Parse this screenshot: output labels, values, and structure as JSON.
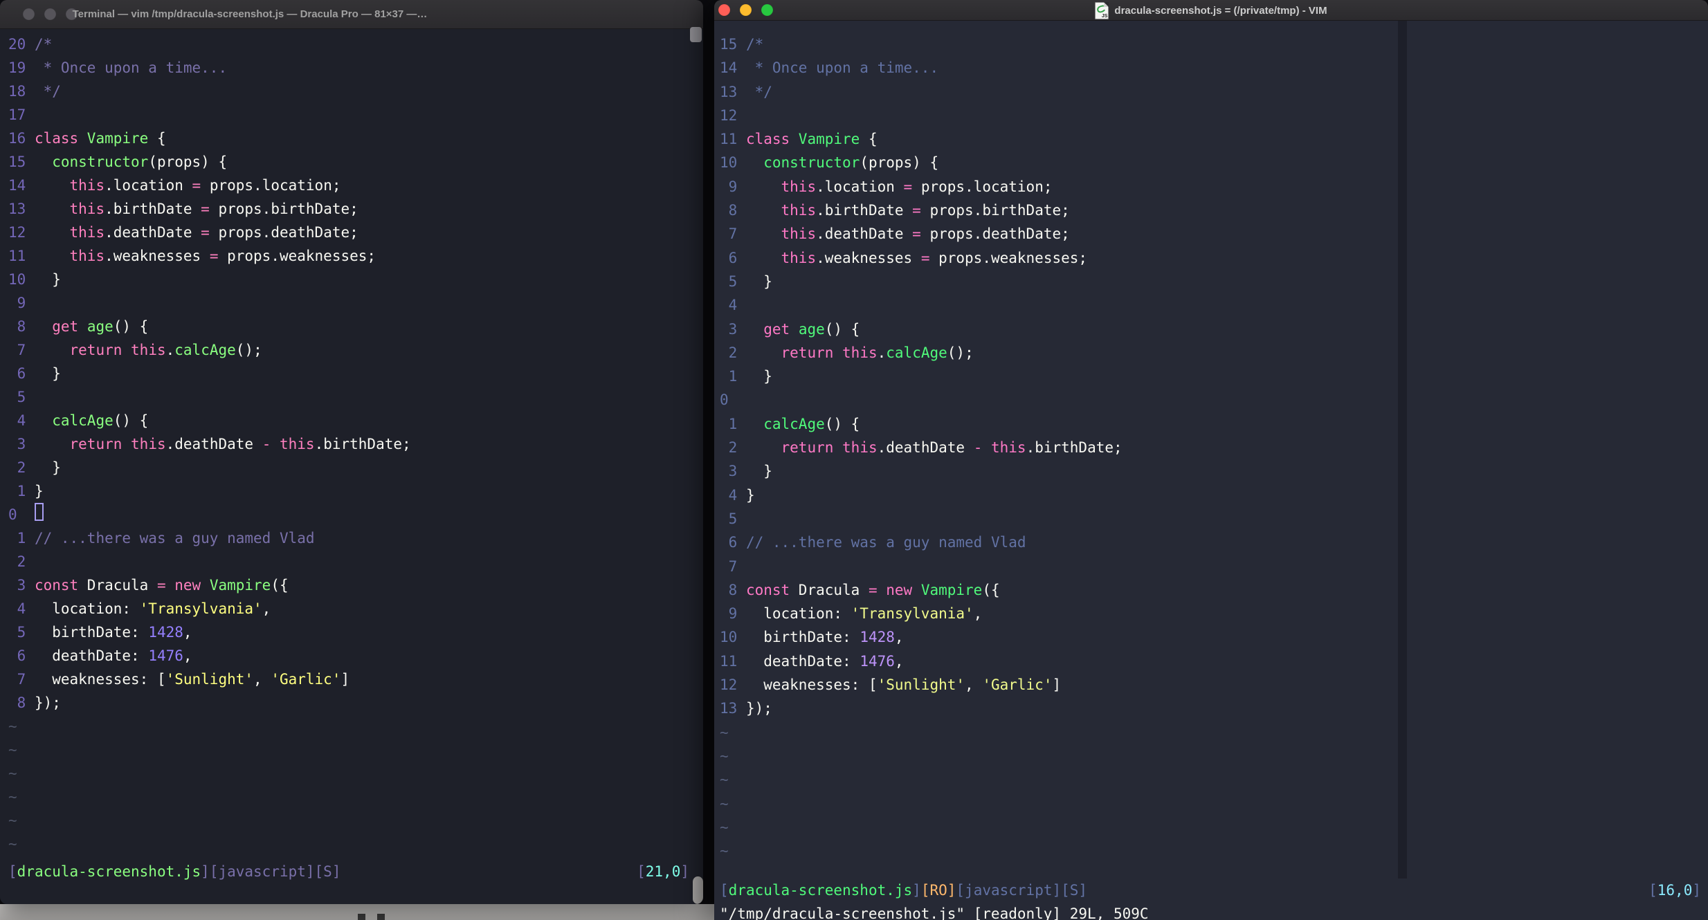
{
  "palettes": {
    "dracula_pro": {
      "bg": "#1E2029",
      "fg": "#F8F8F2",
      "comment": "#7970A9",
      "linenr": "#7467B8",
      "pink": "#FF80BF",
      "green": "#8AFF80",
      "purple": "#9580FF",
      "yellow": "#FFFF80",
      "cyan": "#80FFEA",
      "orange": "#FFCA80",
      "tilde": "#4E5467",
      "cursor": "#A79DF0",
      "colorcolumn": "#1E2029"
    },
    "dracula": {
      "bg": "#262935",
      "fg": "#F8F8F2",
      "comment": "#6272A4",
      "linenr": "#6272A4",
      "pink": "#FF79C6",
      "green": "#50FA7B",
      "purple": "#BD93F9",
      "yellow": "#F1FA8C",
      "cyan": "#8BE9FD",
      "orange": "#FFB86C",
      "tilde": "#565F7C",
      "cursor": "#F8F8F2",
      "colorcolumn": "#1D1F29"
    }
  },
  "code_lines": [
    {
      "t": [
        [
          "c",
          "/*"
        ]
      ]
    },
    {
      "t": [
        [
          "c",
          " * Once upon a time..."
        ]
      ]
    },
    {
      "t": [
        [
          "c",
          " */"
        ]
      ]
    },
    {
      "t": []
    },
    {
      "t": [
        [
          "k",
          "class "
        ],
        [
          "g",
          "Vampire"
        ],
        [
          "w",
          " {"
        ]
      ]
    },
    {
      "t": [
        [
          "w",
          "  "
        ],
        [
          "g",
          "constructor"
        ],
        [
          "w",
          "(props) {"
        ]
      ]
    },
    {
      "t": [
        [
          "w",
          "    "
        ],
        [
          "k",
          "this"
        ],
        [
          "w",
          ".location "
        ],
        [
          "k",
          "="
        ],
        [
          "w",
          " props.location;"
        ]
      ]
    },
    {
      "t": [
        [
          "w",
          "    "
        ],
        [
          "k",
          "this"
        ],
        [
          "w",
          ".birthDate "
        ],
        [
          "k",
          "="
        ],
        [
          "w",
          " props.birthDate;"
        ]
      ]
    },
    {
      "t": [
        [
          "w",
          "    "
        ],
        [
          "k",
          "this"
        ],
        [
          "w",
          ".deathDate "
        ],
        [
          "k",
          "="
        ],
        [
          "w",
          " props.deathDate;"
        ]
      ]
    },
    {
      "t": [
        [
          "w",
          "    "
        ],
        [
          "k",
          "this"
        ],
        [
          "w",
          ".weaknesses "
        ],
        [
          "k",
          "="
        ],
        [
          "w",
          " props.weaknesses;"
        ]
      ]
    },
    {
      "t": [
        [
          "w",
          "  }"
        ]
      ]
    },
    {
      "t": []
    },
    {
      "t": [
        [
          "w",
          "  "
        ],
        [
          "k",
          "get "
        ],
        [
          "g",
          "age"
        ],
        [
          "w",
          "() {"
        ]
      ]
    },
    {
      "t": [
        [
          "w",
          "    "
        ],
        [
          "k",
          "return "
        ],
        [
          "k",
          "this"
        ],
        [
          "w",
          "."
        ],
        [
          "g",
          "calcAge"
        ],
        [
          "w",
          "();"
        ]
      ]
    },
    {
      "t": [
        [
          "w",
          "  }"
        ]
      ]
    },
    {
      "t": []
    },
    {
      "t": [
        [
          "w",
          "  "
        ],
        [
          "g",
          "calcAge"
        ],
        [
          "w",
          "() {"
        ]
      ]
    },
    {
      "t": [
        [
          "w",
          "    "
        ],
        [
          "k",
          "return "
        ],
        [
          "k",
          "this"
        ],
        [
          "w",
          ".deathDate "
        ],
        [
          "k",
          "-"
        ],
        [
          "w",
          " "
        ],
        [
          "k",
          "this"
        ],
        [
          "w",
          ".birthDate;"
        ]
      ]
    },
    {
      "t": [
        [
          "w",
          "  }"
        ]
      ]
    },
    {
      "t": [
        [
          "w",
          "}"
        ]
      ]
    },
    {
      "t": []
    },
    {
      "t": [
        [
          "c",
          "// ...there was a guy named Vlad"
        ]
      ]
    },
    {
      "t": []
    },
    {
      "t": [
        [
          "k",
          "const "
        ],
        [
          "w",
          "Dracula "
        ],
        [
          "k",
          "= new "
        ],
        [
          "g",
          "Vampire"
        ],
        [
          "w",
          "({"
        ]
      ]
    },
    {
      "t": [
        [
          "w",
          "  location: "
        ],
        [
          "s",
          "'Transylvania'"
        ],
        [
          "w",
          ","
        ]
      ]
    },
    {
      "t": [
        [
          "w",
          "  birthDate: "
        ],
        [
          "n",
          "1428"
        ],
        [
          "w",
          ","
        ]
      ]
    },
    {
      "t": [
        [
          "w",
          "  deathDate: "
        ],
        [
          "n",
          "1476"
        ],
        [
          "w",
          ","
        ]
      ]
    },
    {
      "t": [
        [
          "w",
          "  weaknesses: ["
        ],
        [
          "s",
          "'Sunlight'"
        ],
        [
          "w",
          ", "
        ],
        [
          "s",
          "'Garlic'"
        ],
        [
          "w",
          "]"
        ]
      ]
    },
    {
      "t": [
        [
          "w",
          "});"
        ]
      ]
    }
  ],
  "left_window": {
    "chrome": {
      "title": "Terminal — vim /tmp/dracula-screenshot.js — Dracula Pro — 81×37 —…",
      "traffic_lights": [
        "#56545A",
        "#56545A",
        "#56545A"
      ],
      "state": "inactive"
    },
    "palette": "dracula_pro",
    "gutter": [
      "20 ",
      "19 ",
      "18 ",
      "17 ",
      "16 ",
      "15 ",
      "14 ",
      "13 ",
      "12 ",
      "11 ",
      "10 ",
      " 9 ",
      " 8 ",
      " 7 ",
      " 6 ",
      " 5 ",
      " 4 ",
      " 3 ",
      " 2 ",
      " 1 ",
      "0  ",
      " 1 ",
      " 2 ",
      " 3 ",
      " 4 ",
      " 5 ",
      " 6 ",
      " 7 ",
      " 8 "
    ],
    "cursor_row": 20,
    "tilde": "~",
    "tilde_count": 6,
    "status": {
      "left": [
        [
          "c",
          "["
        ],
        [
          "g",
          "dracula-screenshot.js"
        ],
        [
          "c",
          "][javascript][S]"
        ]
      ],
      "ruler": [
        [
          "c",
          "["
        ],
        [
          "y",
          "21,0"
        ],
        [
          "c",
          "]"
        ]
      ]
    }
  },
  "right_window": {
    "chrome": {
      "title": "dracula-screenshot.js = (/private/tmp) - VIM",
      "icon_label": "JS",
      "traffic_lights": [
        "#FF5F57",
        "#FEBC2E",
        "#28C840"
      ],
      "state": "active"
    },
    "palette": "dracula",
    "gutter": [
      "15 ",
      "14 ",
      "13 ",
      "12 ",
      "11 ",
      "10 ",
      " 9 ",
      " 8 ",
      " 7 ",
      " 6 ",
      " 5 ",
      " 4 ",
      " 3 ",
      " 2 ",
      " 1 ",
      "0  ",
      " 1 ",
      " 2 ",
      " 3 ",
      " 4 ",
      " 5 ",
      " 6 ",
      " 7 ",
      " 8 ",
      " 9 ",
      "10 ",
      "11 ",
      "12 ",
      "13 "
    ],
    "cursor_row": -1,
    "tilde": "~",
    "tilde_count": 6,
    "status": {
      "left": [
        [
          "c",
          "["
        ],
        [
          "g",
          "dracula-screenshot.js"
        ],
        [
          "c",
          "]"
        ],
        [
          "o",
          "[RO]"
        ],
        [
          "c",
          "[javascript][S]"
        ]
      ],
      "ruler": [
        [
          "c",
          "["
        ],
        [
          "y",
          "16,0"
        ],
        [
          "c",
          "]"
        ]
      ]
    },
    "cmdline": "\"/tmp/dracula-screenshot.js\" [readonly] 29L, 509C"
  },
  "background_strip": {
    "gradient_top": "#d4d2d0",
    "gradient_bottom": "#aeacaa",
    "mark_color": "#3b3b3b"
  }
}
